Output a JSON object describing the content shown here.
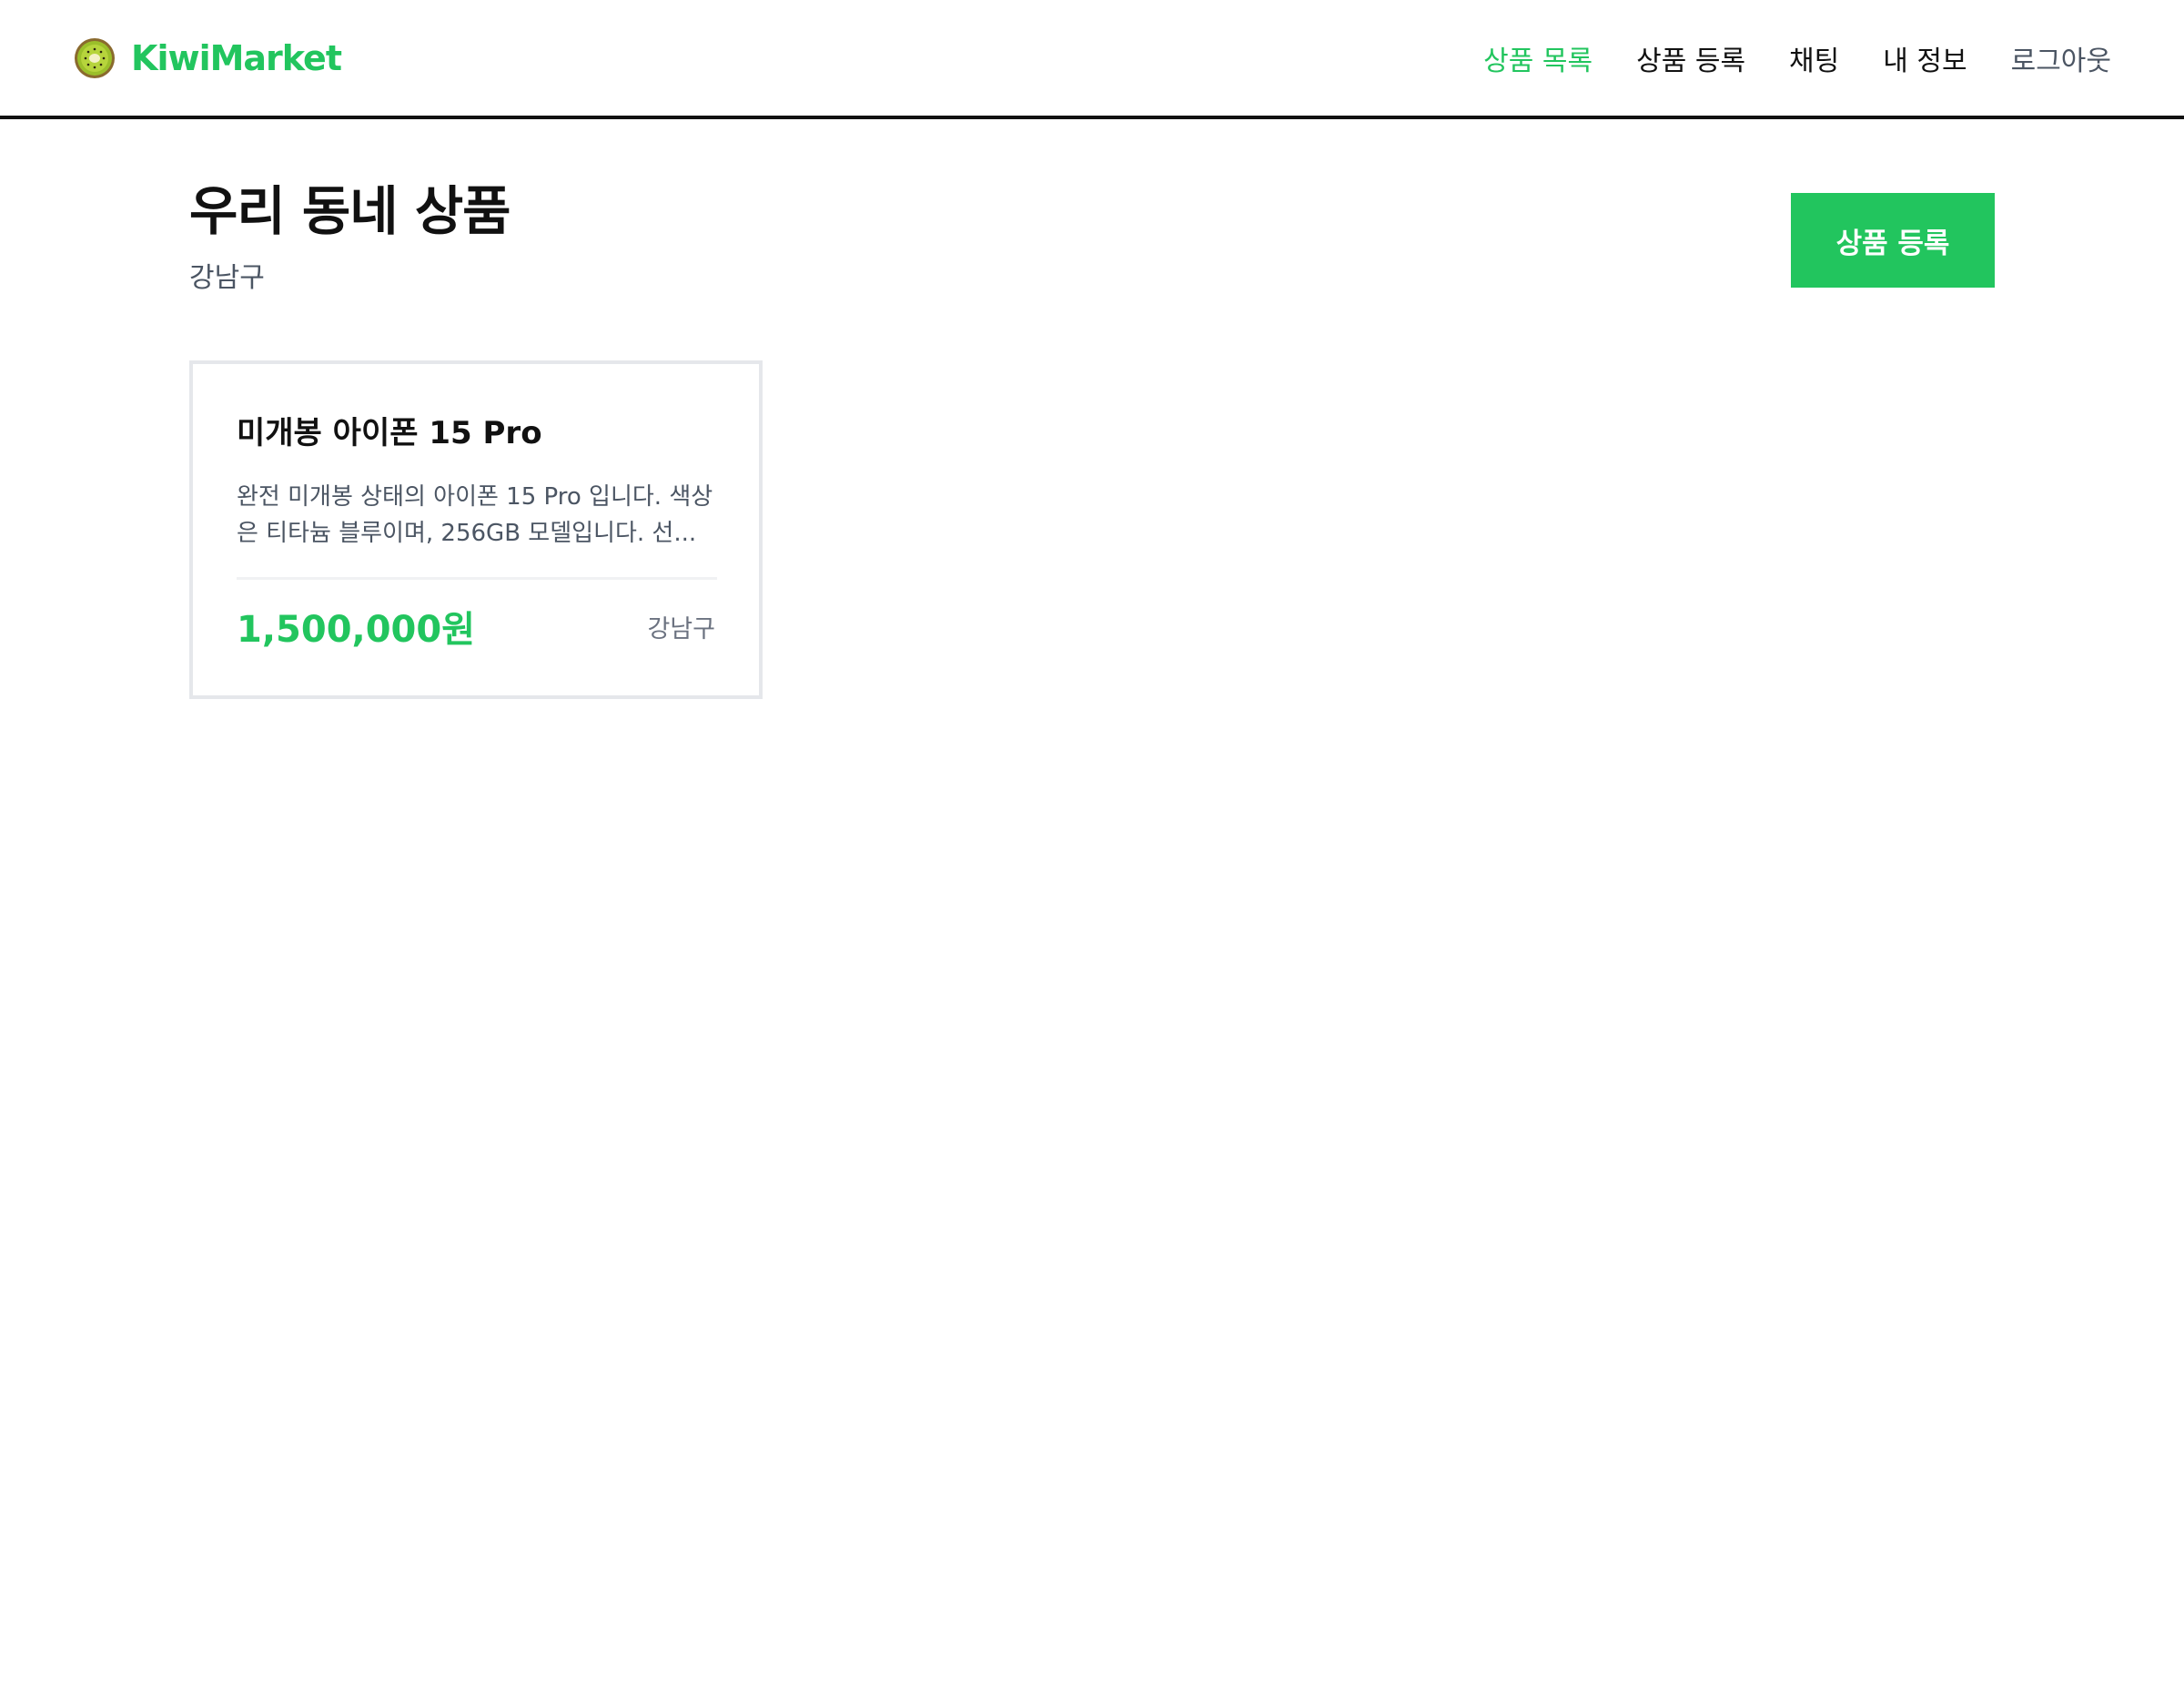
{
  "colors": {
    "brand_green": "#22c55e",
    "text_dark": "#111111",
    "text_gray": "#4b5563",
    "text_muted": "#6b7280",
    "card_border": "#e5e7eb",
    "white": "#ffffff"
  },
  "header": {
    "logo_icon": "kiwi-icon",
    "logo_text": "KiwiMarket",
    "nav": [
      {
        "label": "상품 목록",
        "active": true
      },
      {
        "label": "상품 등록",
        "active": false
      },
      {
        "label": "채팅",
        "active": false
      },
      {
        "label": "내 정보",
        "active": false
      },
      {
        "label": "로그아웃",
        "active": false
      }
    ]
  },
  "page": {
    "title": "우리 동네 상품",
    "subtitle": "강남구",
    "register_button_label": "상품 등록"
  },
  "products": [
    {
      "title": "미개봉 아이폰 15 Pro",
      "description": "완전 미개봉 상태의 아이폰 15 Pro 입니다. 색상은 티타늄 블루이며, 256GB 모델입니다. 선...",
      "price": "1,500,000원",
      "location": "강남구"
    }
  ]
}
